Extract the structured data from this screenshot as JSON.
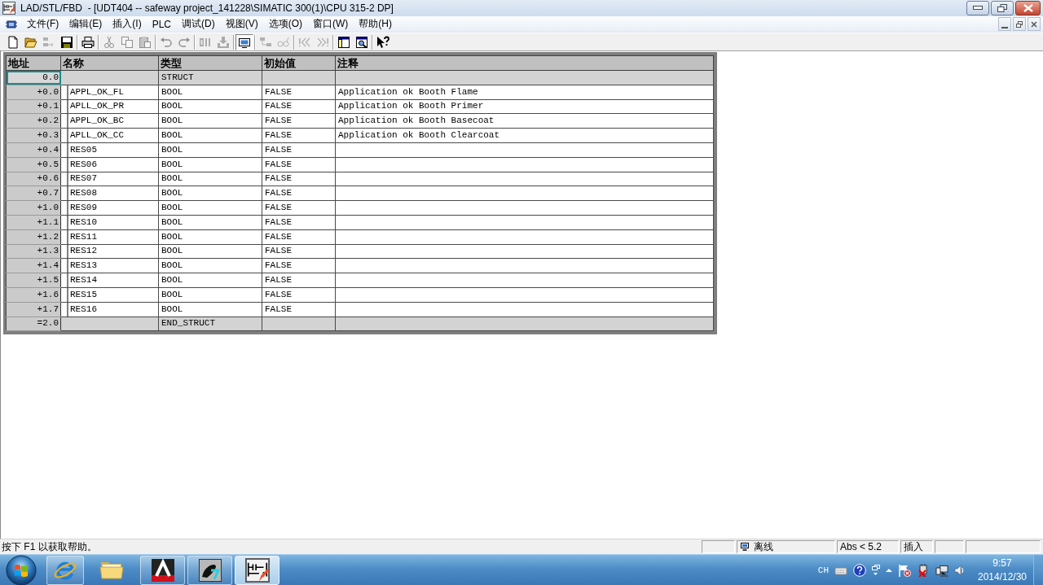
{
  "window": {
    "title": "LAD/STL/FBD  - [UDT404 -- safeway project_141228\\SIMATIC 300(1)\\CPU 315-2 DP]"
  },
  "menu": [
    "文件(F)",
    "编辑(E)",
    "插入(I)",
    "PLC",
    "调试(D)",
    "视图(V)",
    "选项(O)",
    "窗口(W)",
    "帮助(H)"
  ],
  "toolbar": {
    "groups": [
      [
        {
          "disabled": false,
          "pressed": false
        },
        {
          "disabled": false,
          "pressed": false
        },
        {
          "disabled": true,
          "pressed": false
        },
        {
          "disabled": false,
          "pressed": false
        }
      ],
      [
        {
          "disabled": false,
          "pressed": false
        }
      ],
      [
        {
          "disabled": true,
          "pressed": false
        },
        {
          "disabled": true,
          "pressed": false
        },
        {
          "disabled": true,
          "pressed": false
        }
      ],
      [
        {
          "disabled": true,
          "pressed": false
        },
        {
          "disabled": true,
          "pressed": false
        }
      ],
      [
        {
          "disabled": true,
          "pressed": false
        },
        {
          "disabled": true,
          "pressed": false
        }
      ],
      [
        {
          "disabled": false,
          "pressed": true
        }
      ],
      [
        {
          "disabled": true,
          "pressed": false
        },
        {
          "disabled": true,
          "pressed": false
        }
      ],
      [
        {
          "disabled": true,
          "pressed": false
        },
        {
          "disabled": true,
          "pressed": false
        }
      ],
      [
        {
          "disabled": false,
          "pressed": false
        },
        {
          "disabled": false,
          "pressed": false
        }
      ],
      [
        {
          "disabled": false,
          "pressed": false
        }
      ]
    ]
  },
  "table": {
    "columns": [
      "地址",
      "名称",
      "类型",
      "初始值",
      "注释"
    ],
    "rows": [
      {
        "kind": "struct",
        "selected": true,
        "address": "0.0",
        "type": "STRUCT"
      },
      {
        "kind": "member",
        "selected": false,
        "address": "+0.0",
        "name": "APPL_OK_FL",
        "type": "BOOL",
        "initial_value": "FALSE",
        "comment": "Application ok Booth Flame"
      },
      {
        "kind": "member",
        "selected": false,
        "address": "+0.1",
        "name": "APLL_OK_PR",
        "type": "BOOL",
        "initial_value": "FALSE",
        "comment": "Application ok Booth Primer"
      },
      {
        "kind": "member",
        "selected": false,
        "address": "+0.2",
        "name": "APPL_OK_BC",
        "type": "BOOL",
        "initial_value": "FALSE",
        "comment": "Application ok Booth Basecoat"
      },
      {
        "kind": "member",
        "selected": false,
        "address": "+0.3",
        "name": "APLL_OK_CC",
        "type": "BOOL",
        "initial_value": "FALSE",
        "comment": "Application ok Booth Clearcoat"
      },
      {
        "kind": "member",
        "selected": false,
        "address": "+0.4",
        "name": "RES05",
        "type": "BOOL",
        "initial_value": "FALSE"
      },
      {
        "kind": "member",
        "selected": false,
        "address": "+0.5",
        "name": "RES06",
        "type": "BOOL",
        "initial_value": "FALSE"
      },
      {
        "kind": "member",
        "selected": false,
        "address": "+0.6",
        "name": "RES07",
        "type": "BOOL",
        "initial_value": "FALSE"
      },
      {
        "kind": "member",
        "selected": false,
        "address": "+0.7",
        "name": "RES08",
        "type": "BOOL",
        "initial_value": "FALSE"
      },
      {
        "kind": "member",
        "selected": false,
        "address": "+1.0",
        "name": "RES09",
        "type": "BOOL",
        "initial_value": "FALSE"
      },
      {
        "kind": "member",
        "selected": false,
        "address": "+1.1",
        "name": "RES10",
        "type": "BOOL",
        "initial_value": "FALSE"
      },
      {
        "kind": "member",
        "selected": false,
        "address": "+1.2",
        "name": "RES11",
        "type": "BOOL",
        "initial_value": "FALSE"
      },
      {
        "kind": "member",
        "selected": false,
        "address": "+1.3",
        "name": "RES12",
        "type": "BOOL",
        "initial_value": "FALSE"
      },
      {
        "kind": "member",
        "selected": false,
        "address": "+1.4",
        "name": "RES13",
        "type": "BOOL",
        "initial_value": "FALSE"
      },
      {
        "kind": "member",
        "selected": false,
        "address": "+1.5",
        "name": "RES14",
        "type": "BOOL",
        "initial_value": "FALSE"
      },
      {
        "kind": "member",
        "selected": false,
        "address": "+1.6",
        "name": "RES15",
        "type": "BOOL",
        "initial_value": "FALSE"
      },
      {
        "kind": "member",
        "selected": false,
        "address": "+1.7",
        "name": "RES16",
        "type": "BOOL",
        "initial_value": "FALSE"
      },
      {
        "kind": "struct",
        "selected": false,
        "address": "=2.0",
        "type": "END_STRUCT"
      }
    ]
  },
  "status_bar": {
    "message": "按下 F1 以获取帮助。",
    "panes": [
      {
        "kind": "blank"
      },
      {
        "kind": "connection",
        "text": "离线"
      },
      {
        "kind": "text",
        "text": "Abs < 5.2"
      },
      {
        "kind": "text",
        "text": "插入"
      },
      {
        "kind": "blank"
      },
      {
        "kind": "blank"
      }
    ]
  },
  "taskbar": {
    "buttons": [
      {
        "open": true,
        "active": false
      },
      {
        "open": false,
        "active": false
      },
      {
        "open": true,
        "active": false
      },
      {
        "open": true,
        "active": false
      },
      {
        "open": true,
        "active": true
      }
    ],
    "language": "CH",
    "time": "9:57",
    "date": "2014/12/30"
  }
}
